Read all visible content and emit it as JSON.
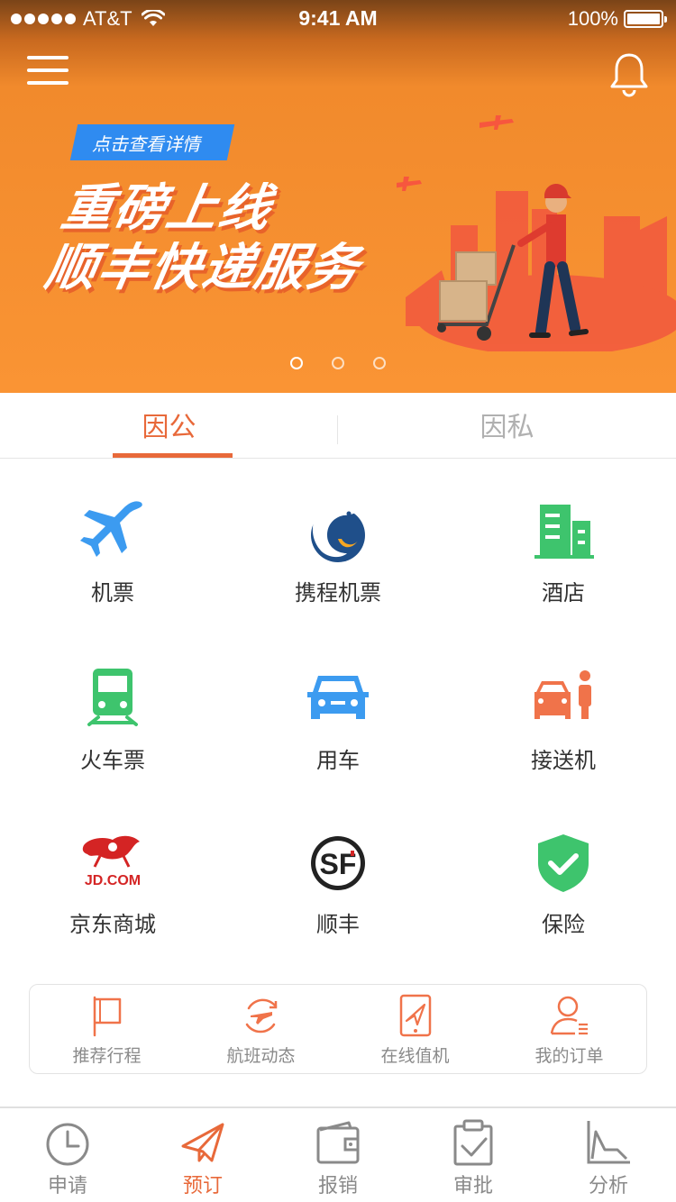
{
  "status_bar": {
    "carrier": "AT&T",
    "time": "9:41 AM",
    "battery": "100%"
  },
  "banner": {
    "tag": "点击查看详情",
    "headline_1": "重磅上线",
    "headline_2": "顺丰快递服务",
    "page_count": 3,
    "active_page": 1
  },
  "tabs": [
    {
      "label": "因公",
      "active": true
    },
    {
      "label": "因私",
      "active": false
    }
  ],
  "services": [
    {
      "label": "机票",
      "icon": "airplane-icon"
    },
    {
      "label": "携程机票",
      "icon": "ctrip-dolphin-icon"
    },
    {
      "label": "酒店",
      "icon": "hotel-building-icon"
    },
    {
      "label": "火车票",
      "icon": "train-icon"
    },
    {
      "label": "用车",
      "icon": "car-icon"
    },
    {
      "label": "接送机",
      "icon": "pickup-car-person-icon"
    },
    {
      "label": "京东商城",
      "icon": "jd-logo-icon",
      "logo_text": "JD.COM"
    },
    {
      "label": "顺丰",
      "icon": "sf-logo-icon",
      "logo_text": "SF"
    },
    {
      "label": "保险",
      "icon": "shield-check-icon"
    }
  ],
  "quick_actions": [
    {
      "label": "推荐行程",
      "icon": "flag-icon"
    },
    {
      "label": "航班动态",
      "icon": "flight-status-icon"
    },
    {
      "label": "在线值机",
      "icon": "online-checkin-icon"
    },
    {
      "label": "我的订单",
      "icon": "my-orders-icon"
    }
  ],
  "tab_bar": [
    {
      "label": "申请",
      "icon": "clock-icon",
      "active": false
    },
    {
      "label": "预订",
      "icon": "paper-plane-icon",
      "active": true
    },
    {
      "label": "报销",
      "icon": "wallet-icon",
      "active": false
    },
    {
      "label": "审批",
      "icon": "clipboard-check-icon",
      "active": false
    },
    {
      "label": "分析",
      "icon": "chart-icon",
      "active": false
    }
  ],
  "colors": {
    "accent": "#e8693a",
    "banner": "#fa9434",
    "blue": "#3c9bf0",
    "green": "#3ec46d",
    "orange_icon": "#f0734a",
    "muted": "#8a8a8a"
  }
}
